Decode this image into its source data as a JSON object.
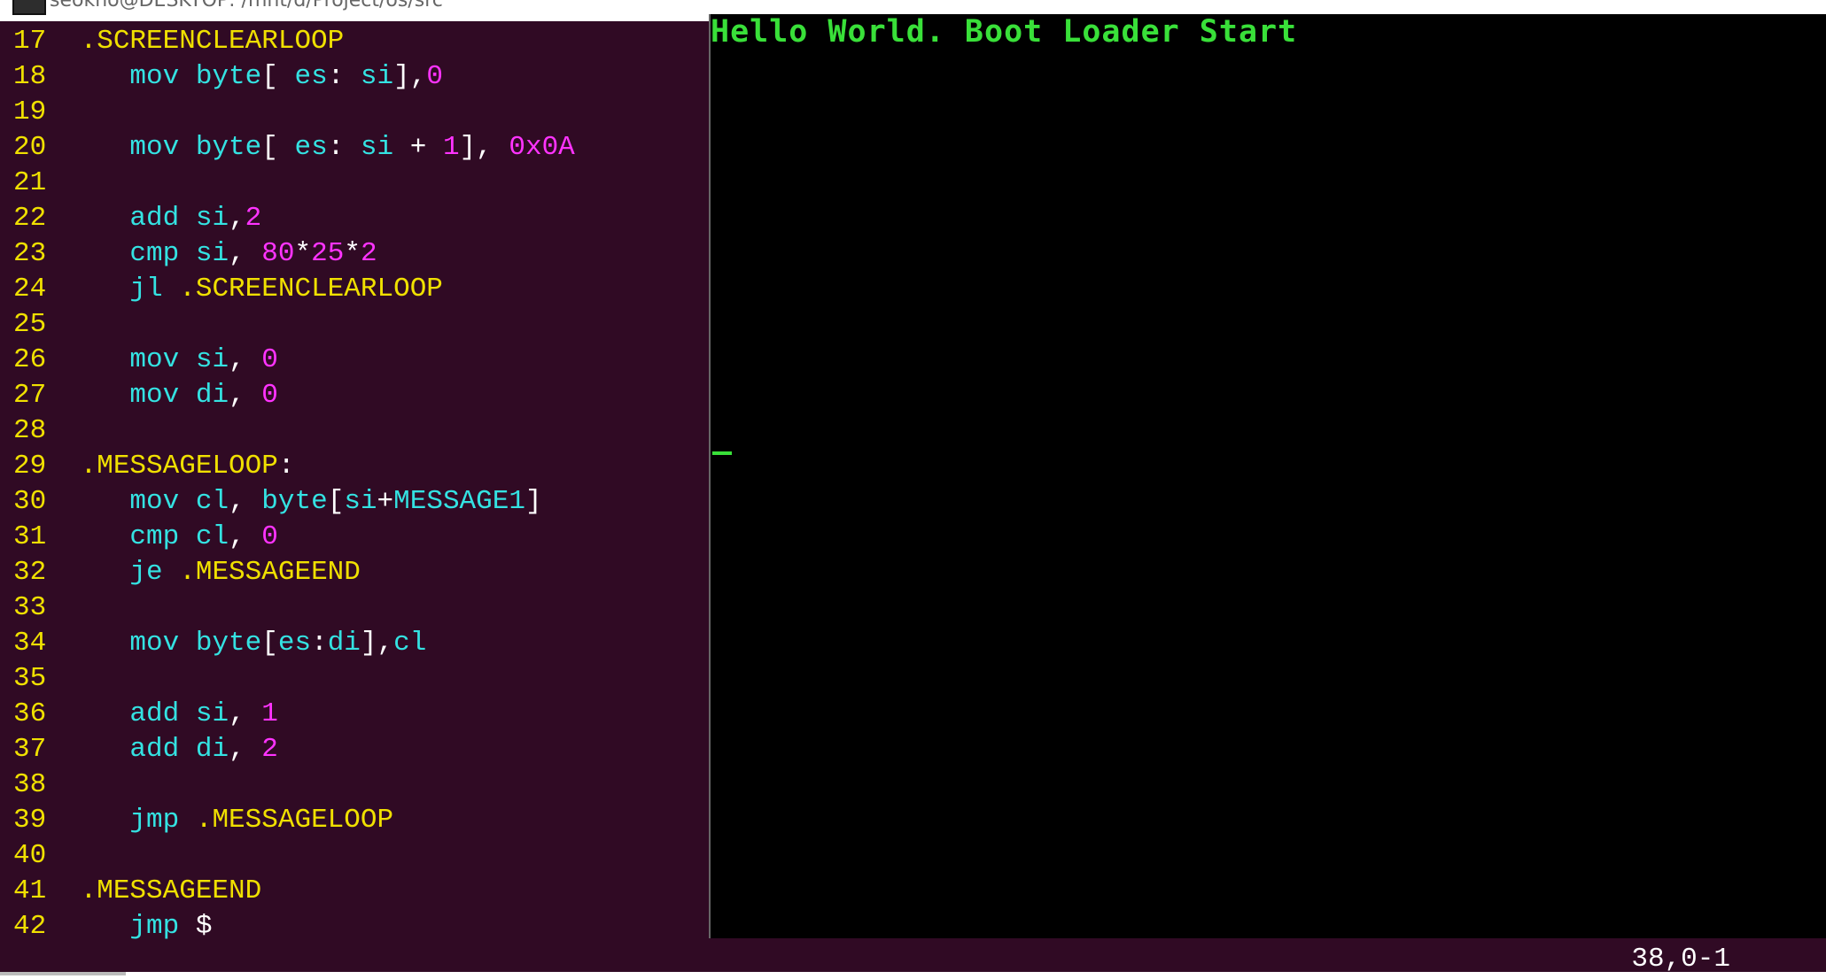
{
  "window": {
    "title": "seokho@DESKTOP: /mnt/d/Project/os/src",
    "icon": "terminal-icon"
  },
  "editor": {
    "lines": [
      {
        "n": "17",
        "parts": [
          {
            "t": " ",
            "c": "wh"
          },
          {
            "t": ".SCREENCLEARLOOP",
            "c": "yl"
          }
        ]
      },
      {
        "n": "18",
        "parts": [
          {
            "t": "    ",
            "c": "wh"
          },
          {
            "t": "mov",
            "c": "cy"
          },
          {
            "t": " ",
            "c": "wh"
          },
          {
            "t": "byte",
            "c": "cy"
          },
          {
            "t": "[ ",
            "c": "wh"
          },
          {
            "t": "es",
            "c": "cy"
          },
          {
            "t": ": ",
            "c": "wh"
          },
          {
            "t": "si",
            "c": "cy"
          },
          {
            "t": "],",
            "c": "wh"
          },
          {
            "t": "0",
            "c": "mg"
          }
        ]
      },
      {
        "n": "19",
        "parts": []
      },
      {
        "n": "20",
        "parts": [
          {
            "t": "    ",
            "c": "wh"
          },
          {
            "t": "mov",
            "c": "cy"
          },
          {
            "t": " ",
            "c": "wh"
          },
          {
            "t": "byte",
            "c": "cy"
          },
          {
            "t": "[ ",
            "c": "wh"
          },
          {
            "t": "es",
            "c": "cy"
          },
          {
            "t": ": ",
            "c": "wh"
          },
          {
            "t": "si",
            "c": "cy"
          },
          {
            "t": " + ",
            "c": "wh"
          },
          {
            "t": "1",
            "c": "mg"
          },
          {
            "t": "], ",
            "c": "wh"
          },
          {
            "t": "0x0A",
            "c": "mg"
          }
        ]
      },
      {
        "n": "21",
        "parts": []
      },
      {
        "n": "22",
        "parts": [
          {
            "t": "    ",
            "c": "wh"
          },
          {
            "t": "add",
            "c": "cy"
          },
          {
            "t": " ",
            "c": "wh"
          },
          {
            "t": "si",
            "c": "cy"
          },
          {
            "t": ",",
            "c": "wh"
          },
          {
            "t": "2",
            "c": "mg"
          }
        ]
      },
      {
        "n": "23",
        "parts": [
          {
            "t": "    ",
            "c": "wh"
          },
          {
            "t": "cmp",
            "c": "cy"
          },
          {
            "t": " ",
            "c": "wh"
          },
          {
            "t": "si",
            "c": "cy"
          },
          {
            "t": ", ",
            "c": "wh"
          },
          {
            "t": "80",
            "c": "mg"
          },
          {
            "t": "*",
            "c": "wh"
          },
          {
            "t": "25",
            "c": "mg"
          },
          {
            "t": "*",
            "c": "wh"
          },
          {
            "t": "2",
            "c": "mg"
          }
        ]
      },
      {
        "n": "24",
        "parts": [
          {
            "t": "    ",
            "c": "wh"
          },
          {
            "t": "jl",
            "c": "cy"
          },
          {
            "t": " ",
            "c": "wh"
          },
          {
            "t": ".SCREENCLEARLOOP",
            "c": "yl"
          }
        ]
      },
      {
        "n": "25",
        "parts": []
      },
      {
        "n": "26",
        "parts": [
          {
            "t": "    ",
            "c": "wh"
          },
          {
            "t": "mov",
            "c": "cy"
          },
          {
            "t": " ",
            "c": "wh"
          },
          {
            "t": "si",
            "c": "cy"
          },
          {
            "t": ", ",
            "c": "wh"
          },
          {
            "t": "0",
            "c": "mg"
          }
        ]
      },
      {
        "n": "27",
        "parts": [
          {
            "t": "    ",
            "c": "wh"
          },
          {
            "t": "mov",
            "c": "cy"
          },
          {
            "t": " ",
            "c": "wh"
          },
          {
            "t": "di",
            "c": "cy"
          },
          {
            "t": ", ",
            "c": "wh"
          },
          {
            "t": "0",
            "c": "mg"
          }
        ]
      },
      {
        "n": "28",
        "parts": []
      },
      {
        "n": "29",
        "parts": [
          {
            "t": " ",
            "c": "wh"
          },
          {
            "t": ".MESSAGELOOP",
            "c": "yl"
          },
          {
            "t": ":",
            "c": "wh"
          }
        ]
      },
      {
        "n": "30",
        "parts": [
          {
            "t": "    ",
            "c": "wh"
          },
          {
            "t": "mov",
            "c": "cy"
          },
          {
            "t": " ",
            "c": "wh"
          },
          {
            "t": "cl",
            "c": "cy"
          },
          {
            "t": ", ",
            "c": "wh"
          },
          {
            "t": "byte",
            "c": "cy"
          },
          {
            "t": "[",
            "c": "wh"
          },
          {
            "t": "si",
            "c": "cy"
          },
          {
            "t": "+",
            "c": "wh"
          },
          {
            "t": "MESSAGE1",
            "c": "cy"
          },
          {
            "t": "]",
            "c": "wh"
          }
        ]
      },
      {
        "n": "31",
        "parts": [
          {
            "t": "    ",
            "c": "wh"
          },
          {
            "t": "cmp",
            "c": "cy"
          },
          {
            "t": " ",
            "c": "wh"
          },
          {
            "t": "cl",
            "c": "cy"
          },
          {
            "t": ", ",
            "c": "wh"
          },
          {
            "t": "0",
            "c": "mg"
          }
        ]
      },
      {
        "n": "32",
        "parts": [
          {
            "t": "    ",
            "c": "wh"
          },
          {
            "t": "je",
            "c": "cy"
          },
          {
            "t": " ",
            "c": "wh"
          },
          {
            "t": ".MESSAGEEND",
            "c": "yl"
          }
        ]
      },
      {
        "n": "33",
        "parts": []
      },
      {
        "n": "34",
        "parts": [
          {
            "t": "    ",
            "c": "wh"
          },
          {
            "t": "mov",
            "c": "cy"
          },
          {
            "t": " ",
            "c": "wh"
          },
          {
            "t": "byte",
            "c": "cy"
          },
          {
            "t": "[",
            "c": "wh"
          },
          {
            "t": "es",
            "c": "cy"
          },
          {
            "t": ":",
            "c": "wh"
          },
          {
            "t": "di",
            "c": "cy"
          },
          {
            "t": "],",
            "c": "wh"
          },
          {
            "t": "cl",
            "c": "cy"
          }
        ]
      },
      {
        "n": "35",
        "parts": []
      },
      {
        "n": "36",
        "parts": [
          {
            "t": "    ",
            "c": "wh"
          },
          {
            "t": "add",
            "c": "cy"
          },
          {
            "t": " ",
            "c": "wh"
          },
          {
            "t": "si",
            "c": "cy"
          },
          {
            "t": ", ",
            "c": "wh"
          },
          {
            "t": "1",
            "c": "mg"
          }
        ]
      },
      {
        "n": "37",
        "parts": [
          {
            "t": "    ",
            "c": "wh"
          },
          {
            "t": "add",
            "c": "cy"
          },
          {
            "t": " ",
            "c": "wh"
          },
          {
            "t": "di",
            "c": "cy"
          },
          {
            "t": ", ",
            "c": "wh"
          },
          {
            "t": "2",
            "c": "mg"
          }
        ]
      },
      {
        "n": "38",
        "parts": []
      },
      {
        "n": "39",
        "parts": [
          {
            "t": "    ",
            "c": "wh"
          },
          {
            "t": "jmp",
            "c": "cy"
          },
          {
            "t": " ",
            "c": "wh"
          },
          {
            "t": ".MESSAGELOOP",
            "c": "yl"
          }
        ]
      },
      {
        "n": "40",
        "parts": []
      },
      {
        "n": "41",
        "parts": [
          {
            "t": " ",
            "c": "wh"
          },
          {
            "t": ".MESSAGEEND",
            "c": "yl"
          }
        ]
      },
      {
        "n": "42",
        "parts": [
          {
            "t": "    ",
            "c": "wh"
          },
          {
            "t": "jmp",
            "c": "cy"
          },
          {
            "t": " ",
            "c": "wh"
          },
          {
            "t": "$",
            "c": "wh"
          }
        ]
      }
    ],
    "status_position": "38,0-1"
  },
  "emulator": {
    "screen_text": "Hello World. Boot Loader Start"
  },
  "colors": {
    "vim_background": "#300a24",
    "line_number": "#f0e000",
    "keyword": "#34e2e2",
    "number": "#ff33ff",
    "label": "#f0e000",
    "screen_text": "#39e039",
    "screen_background": "#000000"
  }
}
